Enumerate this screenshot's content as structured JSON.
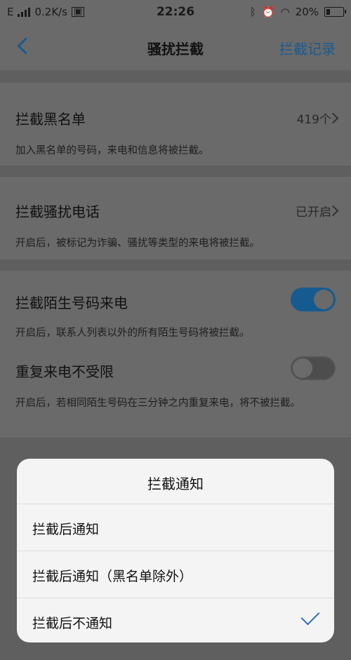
{
  "status_bar": {
    "network": "E",
    "speed": "0.2K/s",
    "time": "22:26",
    "battery": "20%"
  },
  "nav": {
    "title": "骚扰拦截",
    "record": "拦截记录"
  },
  "settings": {
    "blacklist": {
      "label": "拦截黑名单",
      "value": "419个",
      "desc": "加入黑名单的号码，来电和信息将被拦截。"
    },
    "harassment": {
      "label": "拦截骚扰电话",
      "value": "已开启",
      "desc": "开启后，被标记为诈骗、骚扰等类型的来电将被拦截。"
    },
    "strangers": {
      "label": "拦截陌生号码来电",
      "enabled": true,
      "desc": "开启后，联系人列表以外的所有陌生号码将被拦截。"
    },
    "repeat": {
      "label": "重复来电不受限",
      "enabled": false,
      "desc": "开启后，若相同陌生号码在三分钟之内重复来电，将不被拦截。"
    }
  },
  "sheet": {
    "title": "拦截通知",
    "options": [
      {
        "label": "拦截后通知",
        "selected": false
      },
      {
        "label": "拦截后通知（黑名单除外）",
        "selected": false
      },
      {
        "label": "拦截后不通知",
        "selected": true
      }
    ]
  }
}
